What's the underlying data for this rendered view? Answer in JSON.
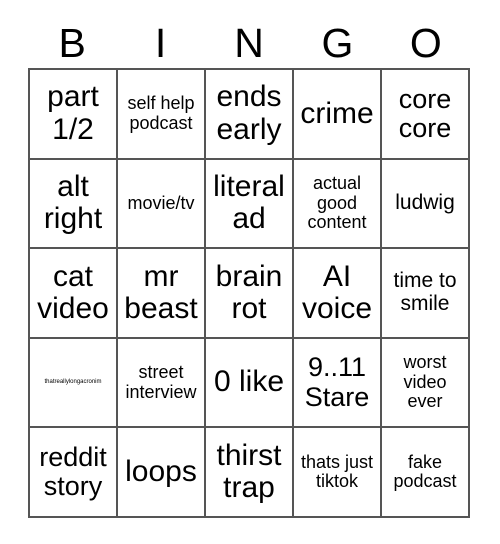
{
  "card": {
    "header_letters": [
      "B",
      "I",
      "N",
      "G",
      "O"
    ],
    "columns": 5,
    "rows": 5,
    "text_color": "#000000",
    "background_color": "#ffffff",
    "border_color": "#555555",
    "cells": [
      [
        {
          "text": "part 1/2",
          "size": "xxl"
        },
        {
          "text": "self help podcast",
          "size": "sm"
        },
        {
          "text": "ends early",
          "size": "xxl"
        },
        {
          "text": "crime",
          "size": "xxl"
        },
        {
          "text": "core core",
          "size": "xl"
        }
      ],
      [
        {
          "text": "alt right",
          "size": "xxl"
        },
        {
          "text": "movie/tv",
          "size": "sm"
        },
        {
          "text": "literal ad",
          "size": "xxl"
        },
        {
          "text": "actual good content",
          "size": "sm"
        },
        {
          "text": "ludwig",
          "size": "md"
        }
      ],
      [
        {
          "text": "cat video",
          "size": "xxl"
        },
        {
          "text": "mr beast",
          "size": "xxl"
        },
        {
          "text": "brain rot",
          "size": "xxl"
        },
        {
          "text": "AI voice",
          "size": "xxl"
        },
        {
          "text": "time to smile",
          "size": "md"
        }
      ],
      [
        {
          "text": "thatreallylongacronim",
          "size": "micro"
        },
        {
          "text": "street interview",
          "size": "sm"
        },
        {
          "text": "0 like",
          "size": "xxl"
        },
        {
          "text": "9..11 Stare",
          "size": "xl"
        },
        {
          "text": "worst video ever",
          "size": "sm"
        }
      ],
      [
        {
          "text": "reddit story",
          "size": "xl"
        },
        {
          "text": "loops",
          "size": "xxl"
        },
        {
          "text": "thirst trap",
          "size": "xxl"
        },
        {
          "text": "thats just tiktok",
          "size": "sm"
        },
        {
          "text": "fake podcast",
          "size": "sm"
        }
      ]
    ]
  }
}
